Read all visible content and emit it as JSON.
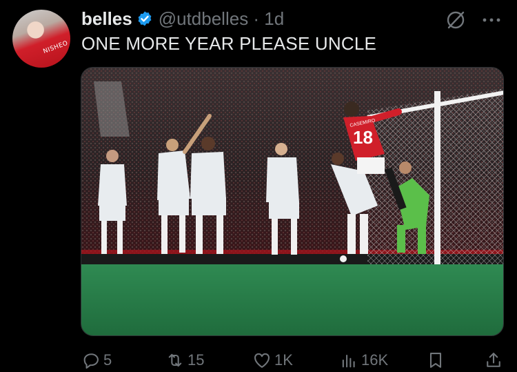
{
  "tweet": {
    "author_name": "belles",
    "handle_time": "@utdbelles · 1d",
    "text": "ONE MORE YEAR PLEASE UNCLE",
    "avatar_shirt_text": "NISHEO"
  },
  "media": {
    "player_number": "18",
    "player_name": "CASEMIRO"
  },
  "actions": {
    "replies": "5",
    "reposts": "15",
    "likes": "1K",
    "views": "16K"
  },
  "icons": [
    "verified-badge-icon",
    "grok-icon",
    "more-icon",
    "reply-icon",
    "repost-icon",
    "like-icon",
    "views-icon",
    "bookmark-icon",
    "share-icon"
  ],
  "colors": {
    "background": "#000000",
    "text": "#e7e9ea",
    "muted": "#71767b",
    "verified": "#1d9bf0",
    "united_red": "#d01f2a"
  }
}
